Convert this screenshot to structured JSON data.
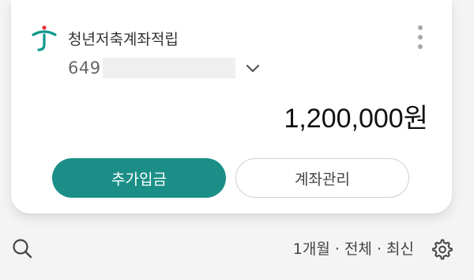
{
  "account": {
    "name": "청년저축계좌적립",
    "number_prefix": "649",
    "balance": "1,200,000원"
  },
  "actions": {
    "deposit_label": "추가입금",
    "manage_label": "계좌관리"
  },
  "filter": {
    "text": "1개월 · 전체 · 최신"
  },
  "icons": {
    "logo": "bank-logo-icon",
    "more": "more-vertical-icon",
    "expand": "chevron-down-icon",
    "search": "search-icon",
    "settings": "gear-icon"
  },
  "colors": {
    "accent": "#1b8f87",
    "logo_green": "#0d9a8c",
    "logo_red": "#e7313e"
  }
}
